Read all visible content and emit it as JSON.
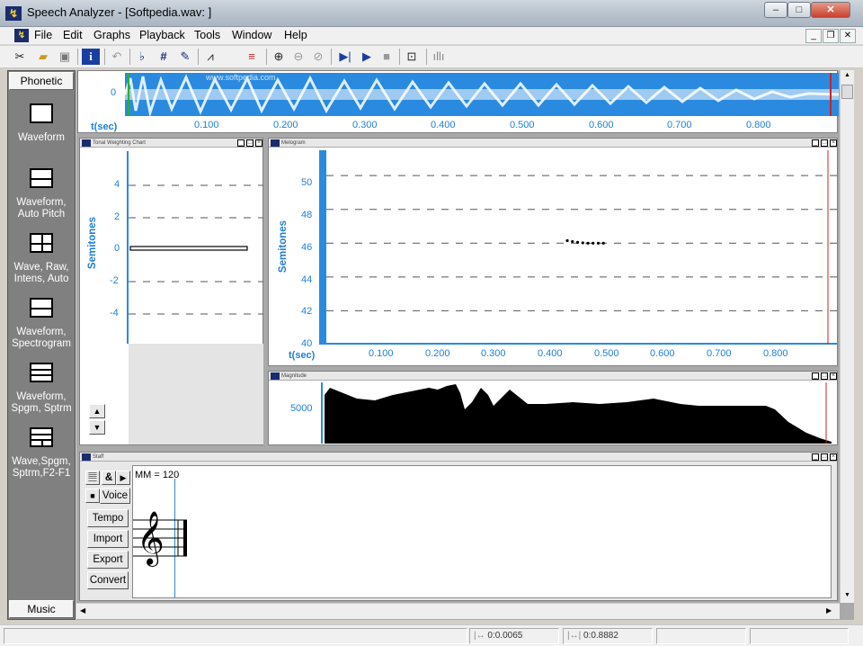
{
  "window": {
    "title": "Speech Analyzer - [Softpedia.wav: ]",
    "minimize": "–",
    "restore": "□",
    "close": "✕"
  },
  "menu": [
    "File",
    "Edit",
    "Graphs",
    "Playback",
    "Tools",
    "Window",
    "Help"
  ],
  "mdi_buttons": [
    "_",
    "❐",
    "✕"
  ],
  "toolbar_icons": [
    "scissors-icon",
    "open-folder-icon",
    "save-icon",
    "info-icon",
    "undo-icon",
    "pitch-icon",
    "hash-icon",
    "edit-pitch-icon",
    "graph-icon",
    "colors-icon",
    "zoom-in-icon",
    "zoom-out-icon",
    "zoom-fit-icon",
    "play-to-end-icon",
    "play-icon",
    "stop-icon",
    "tape-icon",
    "waveform-icon"
  ],
  "sidebar": {
    "header": "Phonetic",
    "footer": "Music",
    "items": [
      {
        "label": "Waveform",
        "icon": "single-pane-icon"
      },
      {
        "label": "Waveform, Auto Pitch",
        "icon": "two-pane-icon"
      },
      {
        "label": "Wave, Raw, Intens, Auto",
        "icon": "four-pane-icon"
      },
      {
        "label": "Waveform, Spectrogram",
        "icon": "two-pane-spectro-icon"
      },
      {
        "label": "Waveform, Spgm, Sptrm",
        "icon": "three-pane-icon"
      },
      {
        "label": "Wave,Spgm, Sptrm,F2-F1",
        "icon": "grid-pane-icon"
      }
    ]
  },
  "waveform": {
    "y_label": "0",
    "x_title": "t(sec)",
    "ticks": [
      "0.100",
      "0.200",
      "0.300",
      "0.400",
      "0.500",
      "0.600",
      "0.700",
      "0.800"
    ],
    "watermark": "www.softpedia.com"
  },
  "tonal_chart": {
    "title": "Tonal Weighting Chart",
    "ylabel": "Semitones",
    "ticks": [
      "4",
      "2",
      "0",
      "-2",
      "-4"
    ]
  },
  "melogram": {
    "title": "Melogram",
    "ylabel": "Semitones",
    "x_title": "t(sec)",
    "yticks": [
      "50",
      "48",
      "46",
      "44",
      "42",
      "40"
    ],
    "xticks": [
      "0.100",
      "0.200",
      "0.300",
      "0.400",
      "0.500",
      "0.600",
      "0.700",
      "0.800"
    ],
    "chart_data": {
      "type": "scatter",
      "x": [
        0.42,
        0.429,
        0.438,
        0.447,
        0.456,
        0.465,
        0.474,
        0.483
      ],
      "y": [
        46.15,
        46.1,
        46.05,
        46.02,
        46.0,
        46.0,
        46.0,
        46.0
      ],
      "ylim": [
        40,
        51.5
      ],
      "xlim": [
        0.0,
        0.89
      ]
    }
  },
  "magnitude": {
    "title": "Magnitude",
    "ytick": "5000"
  },
  "staff": {
    "title": "Staff",
    "tempo_text": "MM = 120",
    "buttons": {
      "voice": "Voice",
      "tempo": "Tempo",
      "import": "Import",
      "export": "Export",
      "convert": "Convert"
    },
    "mini_icons": [
      "staff-icon",
      "ampersand-icon",
      "play-icon",
      "stop-icon"
    ]
  },
  "status": {
    "cursor_start": "0:0.0065",
    "cursor_end": "0:0.8882"
  }
}
